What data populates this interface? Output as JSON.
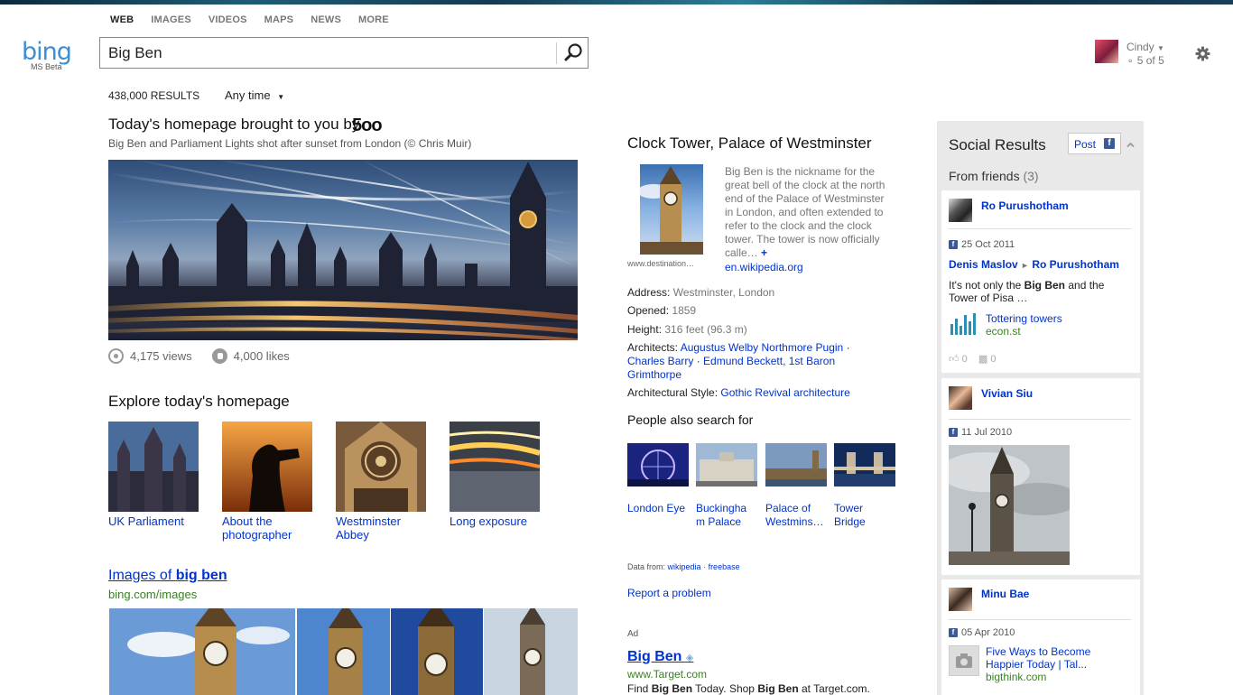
{
  "header": {
    "logo": "bing",
    "logo_sub": "MS Beta",
    "nav": [
      "WEB",
      "IMAGES",
      "VIDEOS",
      "MAPS",
      "NEWS",
      "MORE"
    ],
    "active_nav": "WEB",
    "query": "Big Ben",
    "user_name": "Cindy",
    "user_count": "5 of 5"
  },
  "filters": {
    "result_count": "438,000 RESULTS",
    "time_filter": "Any time"
  },
  "homepage": {
    "title": "Today's homepage brought to you by",
    "sponsor": "5oo",
    "caption": "Big Ben and Parliament Lights shot after sunset from London (© Chris Muir)",
    "views": "4,175 views",
    "likes": "4,000 likes"
  },
  "explore": {
    "title": "Explore today's homepage",
    "tiles": [
      {
        "label": "UK Parliament"
      },
      {
        "label": "About the photographer"
      },
      {
        "label": "Westminster Abbey"
      },
      {
        "label": "Long exposure"
      }
    ]
  },
  "images_section": {
    "prefix": "Images of ",
    "term": "big ben",
    "url": "bing.com/images"
  },
  "entity": {
    "title": "Clock Tower, Palace of Westminster",
    "image_source": "www.destination…",
    "description": "Big Ben is the nickname for the great bell of the clock at the north end of the Palace of Westminster in London, and often extended to refer to the clock and the clock tower. The tower is now officially calle…",
    "more": "+",
    "wiki_link": "en.wikipedia.org",
    "address_label": "Address:",
    "address": "Westminster, London",
    "opened_label": "Opened:",
    "opened": "1859",
    "height_label": "Height:",
    "height": "316 feet (96.3 m)",
    "architects_label": "Architects:",
    "architect1": "Augustus Welby Northmore Pugin",
    "architect2": "Charles Barry",
    "architect3": "Edmund Beckett, 1st Baron Grimthorpe",
    "style_label": "Architectural Style:",
    "style": "Gothic Revival architecture",
    "people_title": "People also search for",
    "people": [
      {
        "label": "London Eye"
      },
      {
        "label": "Buckingham Palace"
      },
      {
        "label": "Palace of Westmins…"
      },
      {
        "label": "Tower Bridge"
      }
    ],
    "data_from": "Data from:",
    "src1": "wikipedia",
    "src2": "freebase",
    "report": "Report a problem"
  },
  "ad": {
    "label": "Ad",
    "title": "Big Ben",
    "url": "www.Target.com",
    "desc_1": "Find ",
    "desc_2": "Big Ben",
    "desc_3": " Today. Shop ",
    "desc_4": "Big Ben",
    "desc_5": " at Target.com."
  },
  "social": {
    "title": "Social Results",
    "post": "Post",
    "from_friends": "From friends",
    "friends_count": "(3)",
    "cards": [
      {
        "name": "Ro Purushotham",
        "date": "25 Oct 2011",
        "from": "Denis Maslov",
        "to": "Ro Purushotham",
        "text_1": "It's not only the ",
        "text_bold": "Big Ben",
        "text_2": " and the Tower of Pisa …",
        "link": "Tottering towers",
        "domain": "econ.st",
        "likes": "0",
        "comments": "0"
      },
      {
        "name": "Vivian Siu",
        "date": "11 Jul 2010"
      },
      {
        "name": "Minu Bae",
        "date": "05 Apr 2010",
        "link": "Five Ways to Become Happier Today | Tal...",
        "domain": "bigthink.com"
      }
    ]
  }
}
